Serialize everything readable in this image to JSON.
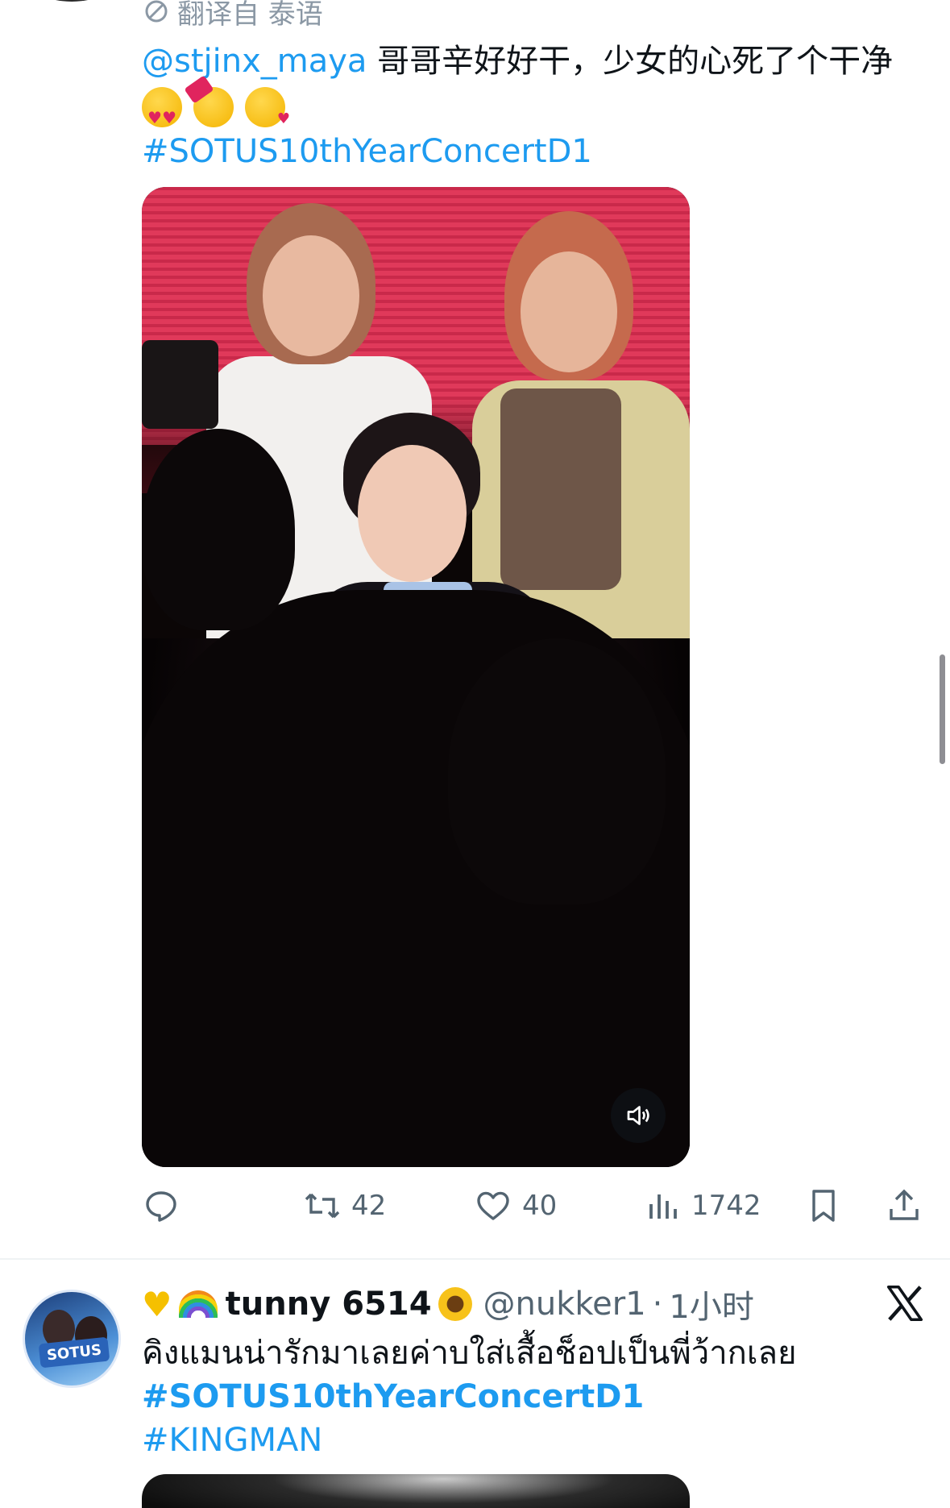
{
  "tweet1": {
    "translate_label": "翻译自 泰语",
    "mention": "@stjinx_maya",
    "text": " 哥哥辛好好干，少女的心死了个干净",
    "emojis": [
      "smiling-face-with-heart-eyes",
      "smiling-face-with-hearts",
      "face-blowing-a-kiss"
    ],
    "hashtag": "#SOTUS10thYearConcertD1",
    "actions": {
      "retweets": "42",
      "likes": "40",
      "views": "1742"
    }
  },
  "tweet2": {
    "display_name": "tunny 6514",
    "handle": "@nukker1",
    "separator": "·",
    "time": "1小时",
    "avatar_badge": "SOTUS",
    "text": "คิงแมนน่ารักมาเลยค่าบใส่เสื้อช็อปเป็นพี่ว้ากเลย",
    "hashtags": [
      "#SOTUS10thYearConcertD1",
      "#KINGMAN"
    ]
  },
  "colors": {
    "accent": "#1d9bf0",
    "muted": "#536471",
    "text": "#0f1419",
    "divider": "#eff3f4"
  }
}
